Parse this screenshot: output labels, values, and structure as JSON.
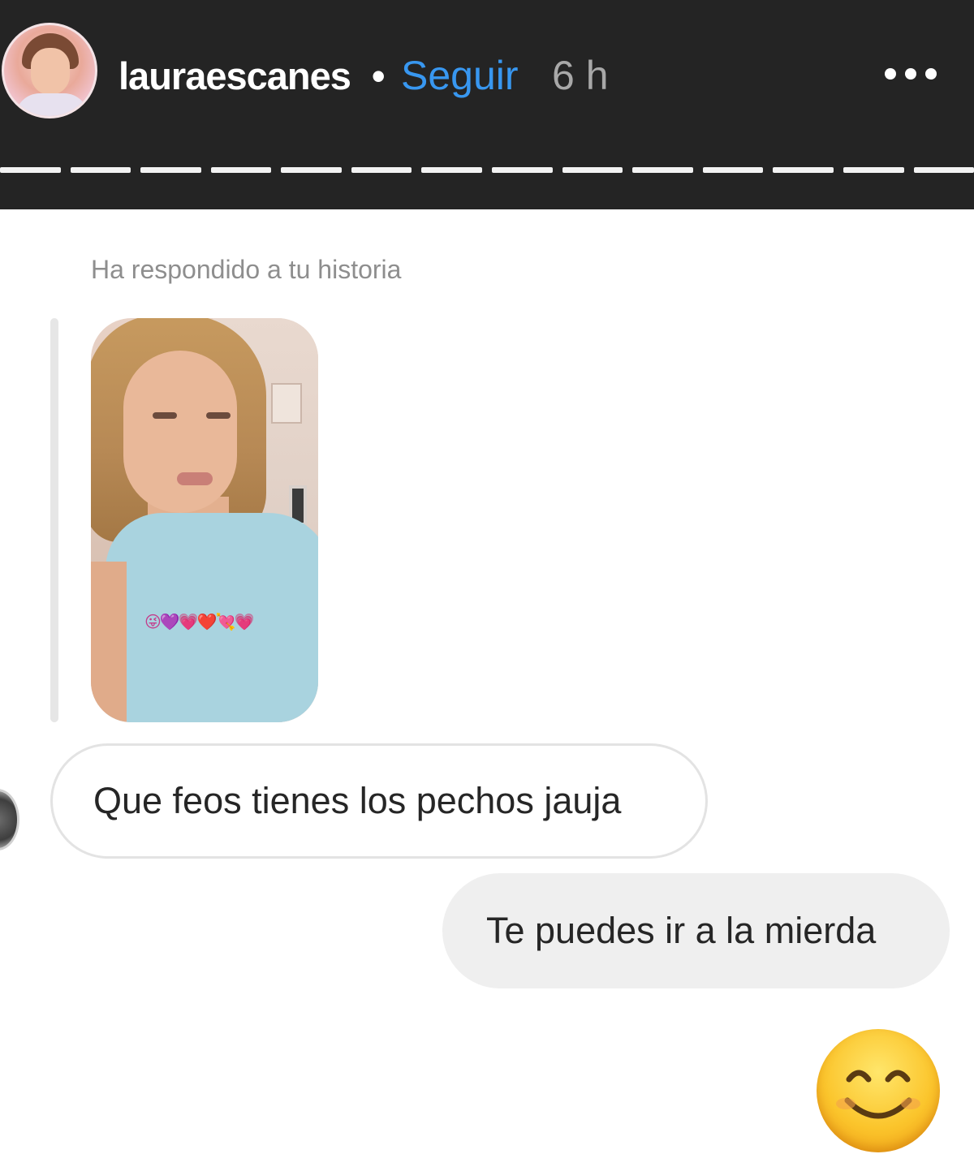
{
  "header": {
    "username": "lauraescanes",
    "separator": "•",
    "follow_label": "Seguir",
    "time": "6 h",
    "progress_segments": 14
  },
  "chat": {
    "reply_label": "Ha respondido a tu historia",
    "story_emoji_overlay": "😜💜💗❤️💘💗",
    "messages": [
      {
        "direction": "incoming",
        "text": "Que feos tienes los pechos jauja"
      },
      {
        "direction": "outgoing",
        "text": "Te puedes ir a la mierda"
      }
    ],
    "reaction_emoji": "smiling-face-icon"
  },
  "colors": {
    "header_bg": "#242424",
    "follow_blue": "#3897f0",
    "outgoing_bubble": "#efefef"
  }
}
